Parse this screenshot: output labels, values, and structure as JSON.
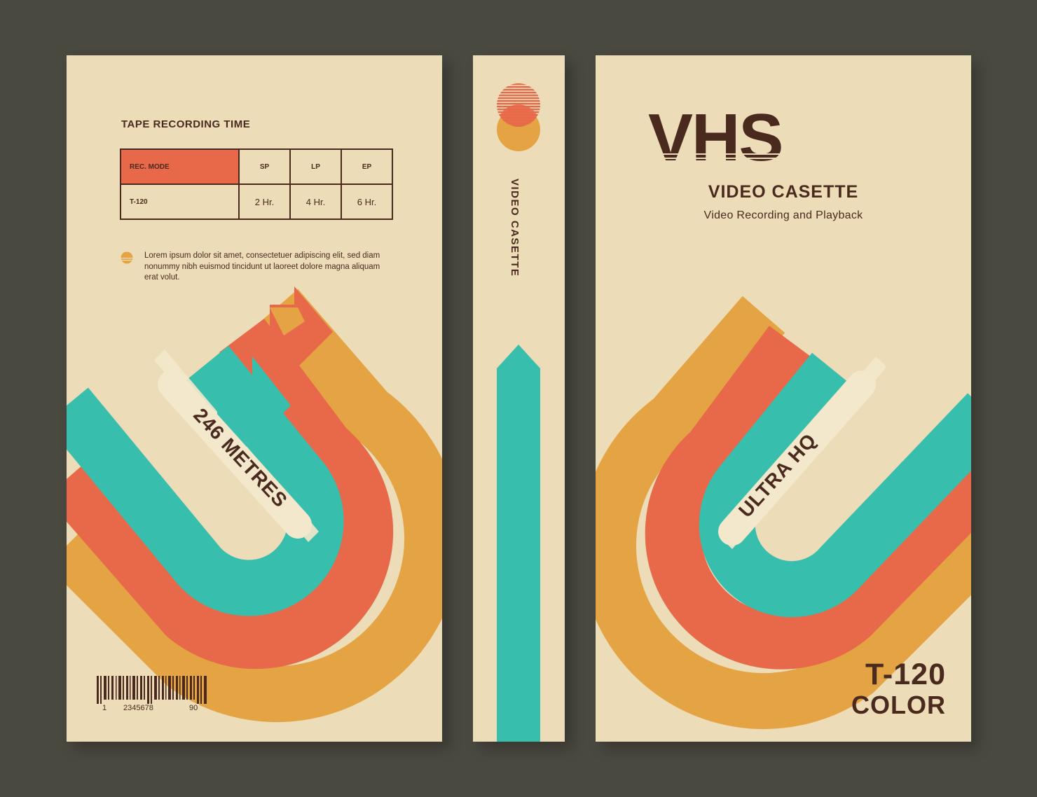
{
  "back": {
    "recording_title": "TAPE RECORDING TIME",
    "table": {
      "headers": [
        "REC. MODE",
        "SP",
        "LP",
        "EP"
      ],
      "row": [
        "T-120",
        "2 Hr.",
        "4 Hr.",
        "6 Hr."
      ]
    },
    "lorem": "Lorem ipsum dolor sit amet, consectetuer adipiscing elit, sed diam nonummy nibh euismod tincidunt ut laoreet dolore magna aliquam erat volut.",
    "metres_label": "246 METRES",
    "barcode": {
      "left": "1",
      "middle": "2345678",
      "right": "90"
    }
  },
  "spine": {
    "label": "VIDEO CASETTE"
  },
  "front": {
    "brand": "VHS",
    "subtitle": "VIDEO CASETTE",
    "tagline": "Video Recording and Playback",
    "quality_label": "ULTRA HQ",
    "model": "T-120",
    "type": "COLOR"
  },
  "colors": {
    "background": "#4a4940",
    "panel": "#ecdcb8",
    "teal": "#37bead",
    "orange": "#e8694a",
    "yellow": "#e4a443",
    "cream": "#f4e8cc",
    "text": "#4a2a1f"
  }
}
